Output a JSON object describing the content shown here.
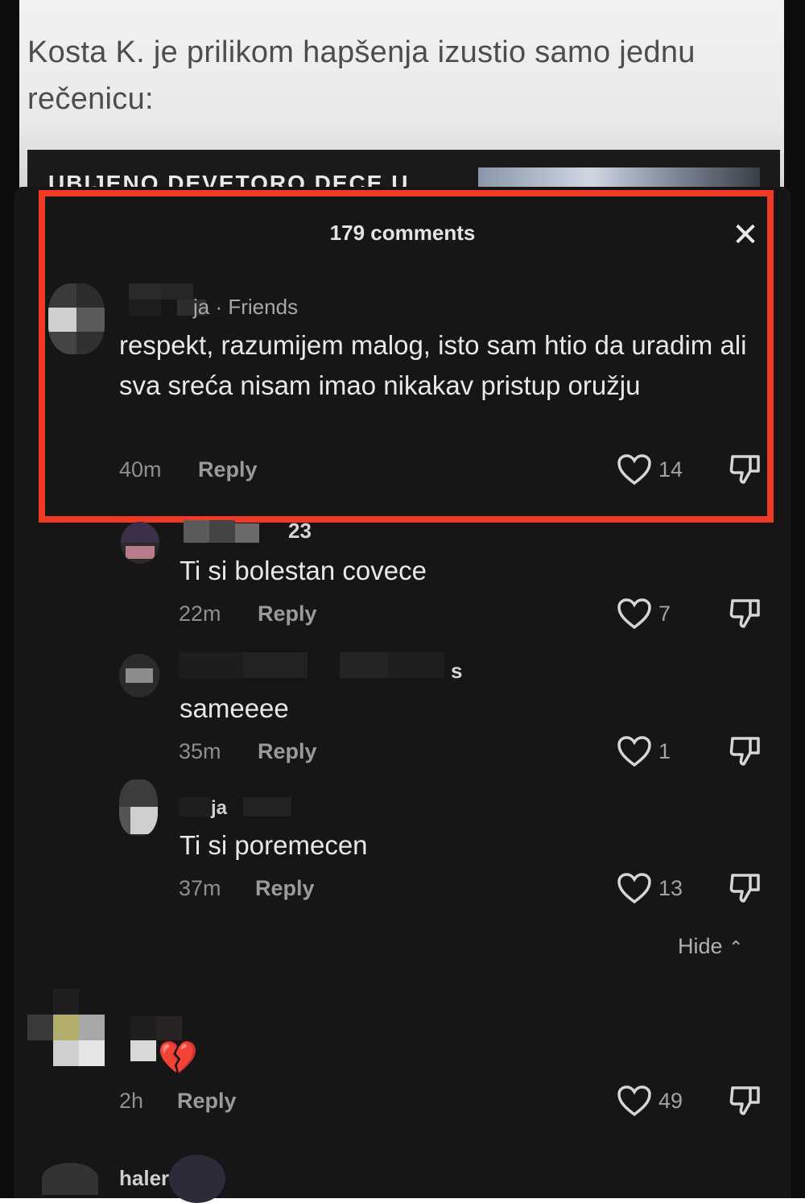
{
  "article": {
    "text": "Kosta K. je prilikom hapšenja izustio samo jednu rečenicu:",
    "banner": "UBIJENO DEVETORO DECE U"
  },
  "sheet": {
    "title": "179 comments",
    "close_icon": "close-icon"
  },
  "comments": [
    {
      "user": "ja",
      "tag": "· Friends",
      "text": "respekt, razumijem malog, isto sam htio da uradim ali sva sreća nisam imao nikakav pristup oružju",
      "time": "40m",
      "reply": "Reply",
      "likes": "14"
    },
    {
      "user": "23",
      "text": "Ti si bolestan covece",
      "time": "22m",
      "reply": "Reply",
      "likes": "7"
    },
    {
      "user": "s",
      "text": "sameeee",
      "time": "35m",
      "reply": "Reply",
      "likes": "1"
    },
    {
      "user": "ja",
      "text": "Ti si poremecen",
      "time": "37m",
      "reply": "Reply",
      "likes": "13"
    },
    {
      "user": "",
      "text": "",
      "time": "2h",
      "reply": "Reply",
      "likes": "49"
    }
  ],
  "hide_label": "Hide",
  "next_user": "haler"
}
